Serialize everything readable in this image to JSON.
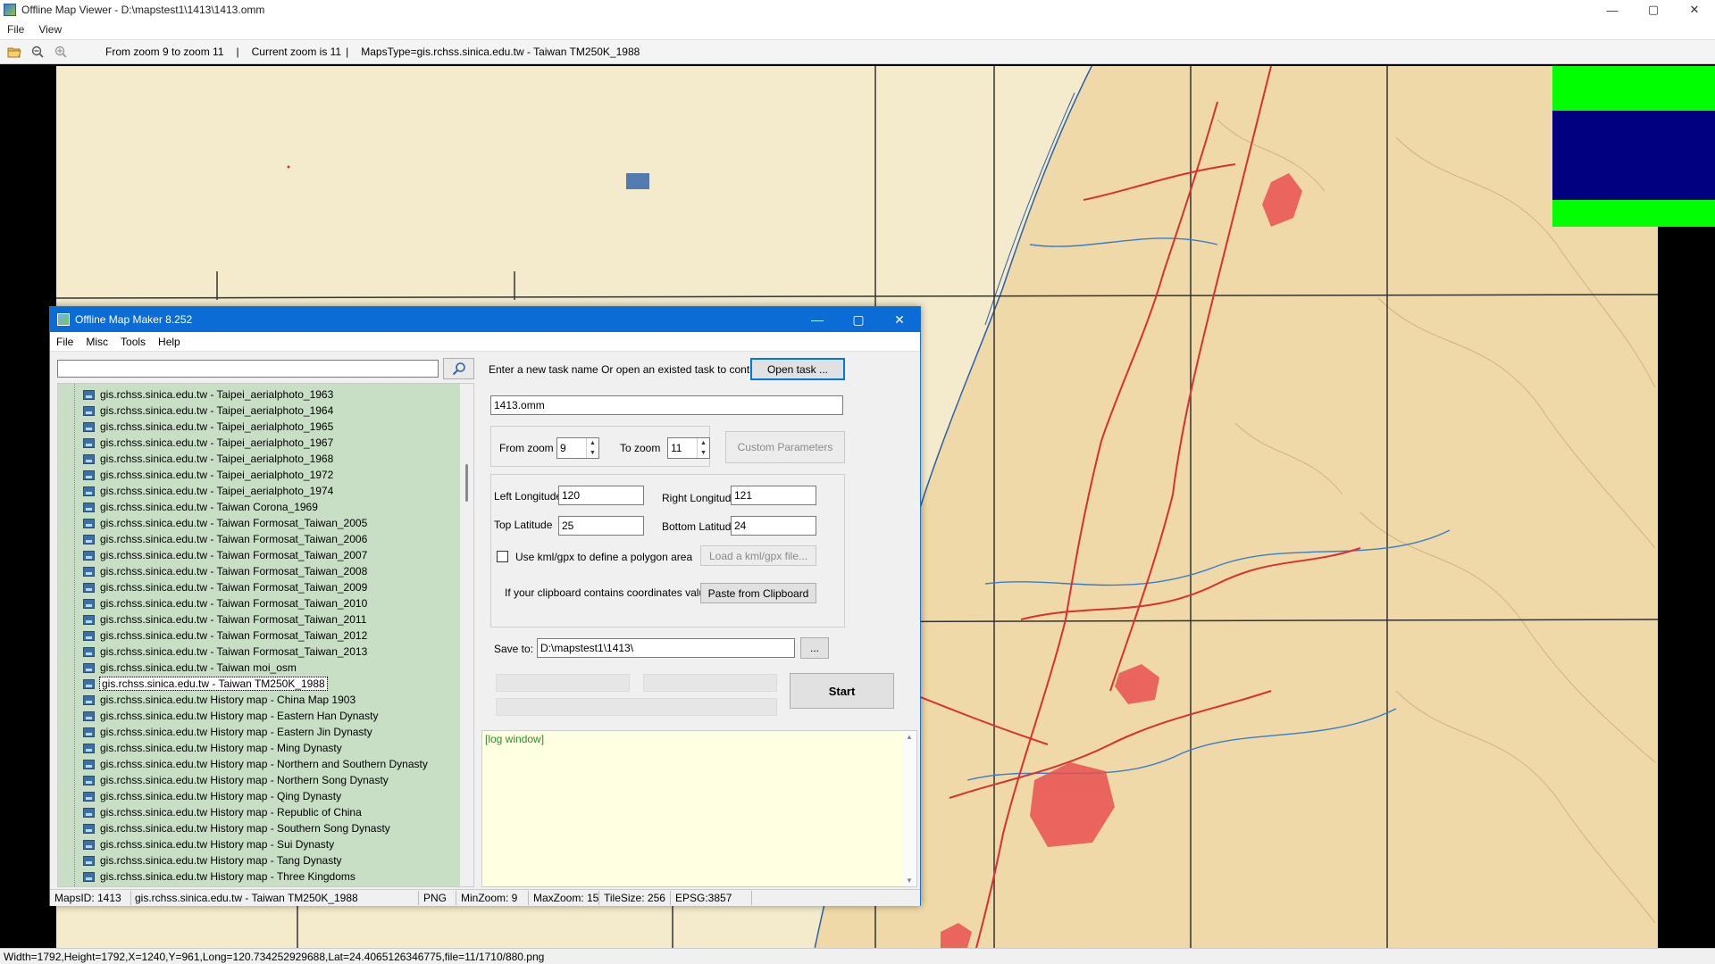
{
  "viewer": {
    "title": "Offline Map Viewer - D:\\mapstest1\\1413\\1413.omm",
    "menu": [
      "File",
      "View"
    ],
    "window_controls": {
      "minimize": "—",
      "maximize": "▢",
      "close": "✕"
    },
    "toolbar": {
      "zoom_range": "From zoom 9 to zoom 11",
      "current_zoom": "Current zoom is 11",
      "maps_type": "MapsType=gis.rchss.sinica.edu.tw - Taiwan TM250K_1988",
      "sep1": "|",
      "sep2": "|"
    },
    "status": "Width=1792,Height=1792,X=1240,Y=961,Long=120.734252929688,Lat=24.4065126346775,file=11/1710/880.png"
  },
  "map": {
    "colors": {
      "land": "#f1e6c2",
      "sea": "#e8e0bc",
      "coastline": "#2a5fa8",
      "roads": "#d93030",
      "grid": "#333333",
      "overlay_green": "#00ff00",
      "overlay_blue": "#000080"
    }
  },
  "omm": {
    "title": "Offline Map Maker 8.252",
    "window_controls": {
      "minimize": "—",
      "maximize": "▢",
      "close": "✕"
    },
    "menu": [
      "File",
      "Misc",
      "Tools",
      "Help"
    ],
    "search": {
      "value": "",
      "button_icon": "search-icon"
    },
    "tree_items": [
      "gis.rchss.sinica.edu.tw - Taipei_aerialphoto_1963",
      "gis.rchss.sinica.edu.tw - Taipei_aerialphoto_1964",
      "gis.rchss.sinica.edu.tw - Taipei_aerialphoto_1965",
      "gis.rchss.sinica.edu.tw - Taipei_aerialphoto_1967",
      "gis.rchss.sinica.edu.tw - Taipei_aerialphoto_1968",
      "gis.rchss.sinica.edu.tw - Taipei_aerialphoto_1972",
      "gis.rchss.sinica.edu.tw - Taipei_aerialphoto_1974",
      "gis.rchss.sinica.edu.tw - Taiwan Corona_1969",
      "gis.rchss.sinica.edu.tw - Taiwan Formosat_Taiwan_2005",
      "gis.rchss.sinica.edu.tw - Taiwan Formosat_Taiwan_2006",
      "gis.rchss.sinica.edu.tw - Taiwan Formosat_Taiwan_2007",
      "gis.rchss.sinica.edu.tw - Taiwan Formosat_Taiwan_2008",
      "gis.rchss.sinica.edu.tw - Taiwan Formosat_Taiwan_2009",
      "gis.rchss.sinica.edu.tw - Taiwan Formosat_Taiwan_2010",
      "gis.rchss.sinica.edu.tw - Taiwan Formosat_Taiwan_2011",
      "gis.rchss.sinica.edu.tw - Taiwan Formosat_Taiwan_2012",
      "gis.rchss.sinica.edu.tw - Taiwan Formosat_Taiwan_2013",
      "gis.rchss.sinica.edu.tw - Taiwan moi_osm",
      "gis.rchss.sinica.edu.tw - Taiwan TM250K_1988",
      "gis.rchss.sinica.edu.tw History map - China Map 1903",
      "gis.rchss.sinica.edu.tw History map - Eastern Han Dynasty",
      "gis.rchss.sinica.edu.tw History map - Eastern Jin Dynasty",
      "gis.rchss.sinica.edu.tw History map - Ming Dynasty",
      "gis.rchss.sinica.edu.tw History map - Northern and Southern Dynasty",
      "gis.rchss.sinica.edu.tw History map - Northern Song Dynasty",
      "gis.rchss.sinica.edu.tw History map - Qing Dynasty",
      "gis.rchss.sinica.edu.tw History map - Republic of China",
      "gis.rchss.sinica.edu.tw History map - Southern Song Dynasty",
      "gis.rchss.sinica.edu.tw History map - Sui Dynasty",
      "gis.rchss.sinica.edu.tw History map - Tang Dynasty",
      "gis.rchss.sinica.edu.tw History map - Three Kingdoms"
    ],
    "selected_index": 18,
    "task": {
      "prompt": "Enter a new task name Or open an existed task to continue:",
      "open_button": "Open task ...",
      "name_value": "1413.omm"
    },
    "zoom": {
      "from_label": "From zoom",
      "from_value": "9",
      "to_label": "To zoom",
      "to_value": "11",
      "custom_button": "Custom Parameters"
    },
    "coords": {
      "left_lon_label": "Left Longitude",
      "left_lon_value": "120",
      "right_lon_label": "Right Longitude",
      "right_lon_value": "121",
      "top_lat_label": "Top Latitude",
      "top_lat_value": "25",
      "bottom_lat_label": "Bottom Latitude",
      "bottom_lat_value": "24",
      "kml_checkbox_label": "Use kml/gpx to define a polygon area",
      "kml_checked": false,
      "load_kml_button": "Load a kml/gpx file...",
      "clipboard_label": "If your clipboard contains coordinates values:",
      "paste_button": "Paste from Clipboard"
    },
    "save": {
      "label": "Save to:",
      "path": "D:\\mapstest1\\1413\\",
      "browse_button": "..."
    },
    "start_button": "Start",
    "log_text": "[log window]",
    "status": {
      "maps_id": "MapsID: 1413",
      "maps_name": "gis.rchss.sinica.edu.tw - Taiwan TM250K_1988",
      "format": "PNG",
      "min_zoom": "MinZoom: 9",
      "max_zoom": "MaxZoom: 15",
      "tile_size": "TileSize: 256",
      "epsg": "EPSG:3857"
    }
  }
}
